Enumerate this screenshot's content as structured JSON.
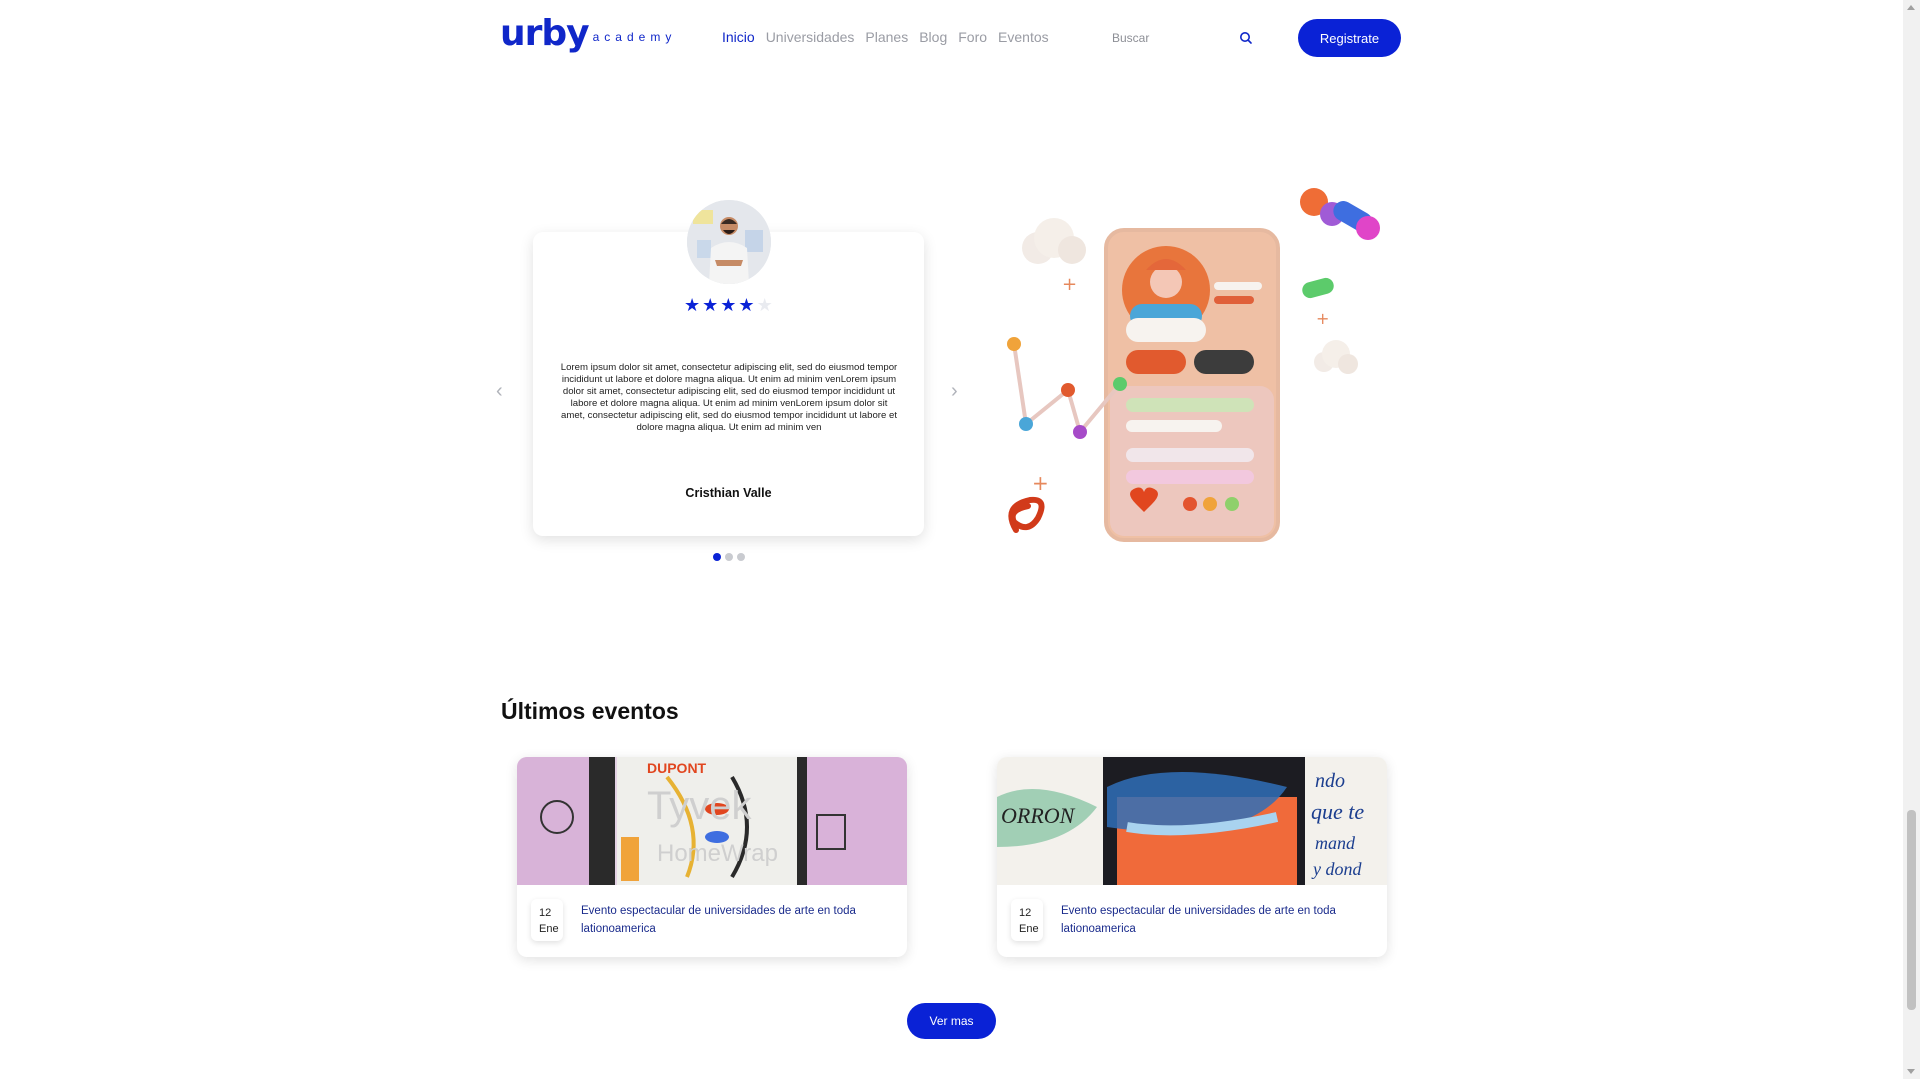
{
  "header": {
    "logo_main": "urby",
    "logo_sub": "academy",
    "nav": [
      "Inicio",
      "Universidades",
      "Planes",
      "Blog",
      "Foro",
      "Eventos"
    ],
    "active_nav": "Inicio",
    "search_placeholder": "Buscar",
    "register_label": "Registrate"
  },
  "testimonial": {
    "rating": 4,
    "rating_max": 5,
    "text": "Lorem ipsum dolor sit amet, consectetur adipiscing elit, sed do eiusmod tempor incididunt ut labore et dolore magna aliqua. Ut enim ad minim venLorem ipsum dolor sit amet, consectetur adipiscing elit, sed do eiusmod tempor incididunt ut labore et dolore magna aliqua. Ut enim ad minim venLorem ipsum dolor sit amet, consectetur adipiscing elit, sed do eiusmod tempor incididunt ut labore et dolore magna aliqua. Ut enim ad minim ven",
    "name": "Cristhian Valle",
    "slides": 3,
    "active_slide": 1
  },
  "events": {
    "title": "Últimos eventos",
    "items": [
      {
        "day": "12",
        "month": "Ene",
        "title": "Evento espectacular de universidades de arte en toda lationoamerica"
      },
      {
        "day": "12",
        "month": "Ene",
        "title": "Evento espectacular de universidades de arte en toda lationoamerica"
      }
    ],
    "more_label": "Ver mas"
  },
  "colors": {
    "accent": "#0a22d6",
    "muted_nav": "#9a9ca4"
  }
}
